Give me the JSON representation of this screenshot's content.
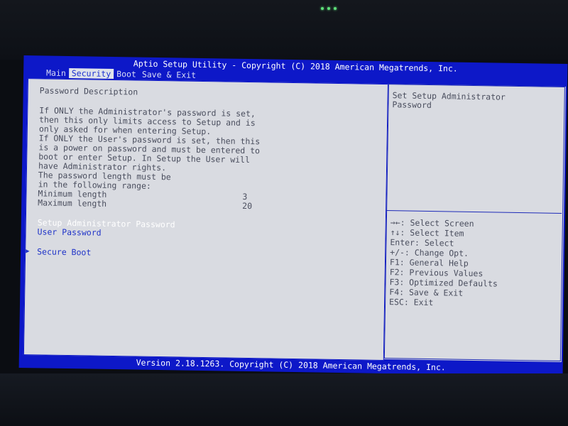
{
  "header": {
    "title": "Aptio Setup Utility - Copyright (C) 2018 American Megatrends, Inc.",
    "tabs": [
      "Main",
      "Security",
      "Boot",
      "Save & Exit"
    ],
    "active_tab": "Security"
  },
  "main": {
    "section_title": "Password Description",
    "description_lines": [
      "If ONLY the Administrator's password is set,",
      "then this only limits access to Setup and is",
      "only asked for when entering Setup.",
      "If ONLY the User's password is set, then this",
      "is a power on password and must be entered to",
      "boot or enter Setup. In Setup the User will",
      "have Administrator rights.",
      "The password length must be",
      "in the following range:"
    ],
    "min_label": "Minimum length",
    "min_value": "3",
    "max_label": "Maximum length",
    "max_value": "20",
    "items": [
      "Setup Administrator Password",
      "User Password"
    ],
    "submenu_arrow": "▶",
    "submenu": "Secure Boot"
  },
  "help": {
    "description": [
      "Set Setup Administrator",
      "Password"
    ],
    "keys": [
      "→←: Select Screen",
      "↑↓: Select Item",
      "Enter: Select",
      "+/-: Change Opt.",
      "F1: General Help",
      "F2: Previous Values",
      "F3: Optimized Defaults",
      "F4: Save & Exit",
      "ESC: Exit"
    ]
  },
  "footer": {
    "version": "Version 2.18.1263. Copyright (C) 2018 American Megatrends, Inc."
  }
}
